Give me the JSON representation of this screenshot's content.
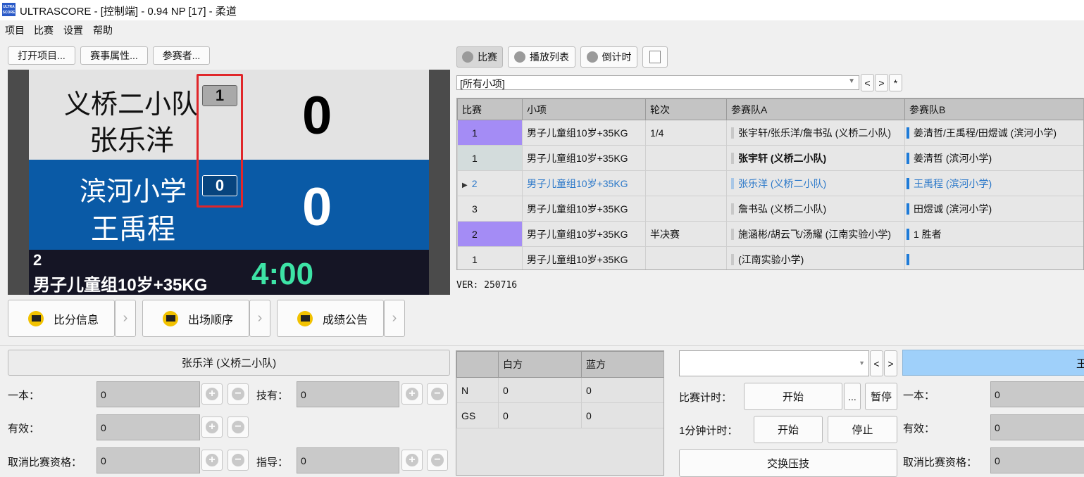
{
  "title_bar": {
    "app_title": "ULTRASCORE - [控制端] - 0.94 NP [17] - 柔道",
    "logo_text": "ULTRA SCORE"
  },
  "menu": [
    "项目",
    "比赛",
    "设置",
    "帮助"
  ],
  "toolbar_left": {
    "open_project": "打开项目...",
    "event_props": "赛事属性...",
    "participants": "参赛者..."
  },
  "scoreboard": {
    "white_team": "义桥二小队",
    "white_name": "张乐洋",
    "white_penalty": "1",
    "white_score": "0",
    "blue_team": "滨河小学",
    "blue_name": "王禹程",
    "blue_penalty": "0",
    "blue_score": "0",
    "match_no": "2",
    "category": "男子儿童组10岁+35KG",
    "clock": "4:00"
  },
  "display_buttons": [
    "比分信息",
    "出场顺序",
    "成绩公告"
  ],
  "tabs": {
    "match": "比赛",
    "playlist": "播放列表",
    "countdown": "倒计时"
  },
  "filter": {
    "value": "[所有小项]",
    "prev": "<",
    "next": ">",
    "all": "*"
  },
  "match_table": {
    "headers": [
      "比赛",
      "小项",
      "轮次",
      "参赛队A",
      "参赛队B"
    ],
    "rows": [
      {
        "no": "1",
        "category": "男子儿童组10岁+35KG",
        "round": "1/4",
        "team_a": "张宇轩/张乐洋/詹书弘 (义桥二小队)",
        "team_b": "姜清哲/王禹程/田煜诚 (滨河小学)"
      },
      {
        "no": "1",
        "category": "男子儿童组10岁+35KG",
        "round": "",
        "team_a": "张宇轩 (义桥二小队)",
        "team_b": "姜清哲 (滨河小学)"
      },
      {
        "no": "2",
        "category": "男子儿童组10岁+35KG",
        "round": "",
        "team_a": "张乐洋 (义桥二小队)",
        "team_b": "王禹程 (滨河小学)"
      },
      {
        "no": "3",
        "category": "男子儿童组10岁+35KG",
        "round": "",
        "team_a": "詹书弘 (义桥二小队)",
        "team_b": "田煜诚 (滨河小学)"
      },
      {
        "no": "2",
        "category": "男子儿童组10岁+35KG",
        "round": "半决赛",
        "team_a": "施涵彬/胡云飞/汤耀 (江南实验小学)",
        "team_b": "1 胜者"
      },
      {
        "no": "1",
        "category": "男子儿童组10岁+35KG",
        "round": "",
        "team_a": " (江南实验小学)",
        "team_b": ""
      }
    ]
  },
  "version": "VER: 250716",
  "white_panel": {
    "name": "张乐洋 (义桥二小队)",
    "ippon_label": "一本：",
    "ippon": "0",
    "waza_label": "技有：",
    "waza": "0",
    "yuko_label": "有效：",
    "yuko": "0",
    "hansoku_label": "取消比赛资格：",
    "hansoku": "0",
    "shido_label": "指导：",
    "shido": "0"
  },
  "stats": {
    "headers": [
      "",
      "白方",
      "蓝方"
    ],
    "rows": [
      {
        "label": "N",
        "white": "0",
        "blue": "0"
      },
      {
        "label": "GS",
        "white": "0",
        "blue": "0"
      }
    ]
  },
  "control": {
    "dropdown": "",
    "prev": "<",
    "next": ">",
    "match_timer_label": "比赛计时：",
    "start": "开始",
    "more": "...",
    "pause": "暂停",
    "minute_timer_label": "1分钟计时：",
    "start2": "开始",
    "stop": "停止",
    "swap": "交换压技"
  },
  "blue_panel": {
    "name": "王",
    "ippon_label": "一本：",
    "ippon": "0",
    "yuko_label": "有效：",
    "yuko": "0",
    "hansoku_label": "取消比赛资格：",
    "hansoku": "0"
  },
  "colors": {
    "blue_band": "#0a5aa6",
    "clock_green": "#3de3a6",
    "highlight_red": "#e0262a",
    "row_purple": "#a48cf5",
    "blue_name_bar": "#9fd0fa"
  }
}
